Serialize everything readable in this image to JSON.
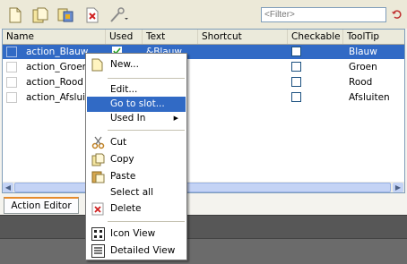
{
  "toolbar": {
    "icons": [
      "new-action-icon",
      "copy-action-icon",
      "configure-icon",
      "delete-icon",
      "tools-icon"
    ],
    "filter_placeholder": "<Filter>"
  },
  "table": {
    "columns": [
      "Name",
      "Used",
      "Text",
      "Shortcut",
      "Checkable",
      "ToolTip"
    ],
    "rows": [
      {
        "name": "action_Blauw",
        "used": true,
        "text": "&Blauw",
        "shortcut": "",
        "checkable": false,
        "tooltip": "Blauw",
        "selected": true
      },
      {
        "name": "action_Groen",
        "used": false,
        "text": "",
        "shortcut": "",
        "checkable": false,
        "tooltip": "Groen",
        "selected": false
      },
      {
        "name": "action_Rood",
        "used": false,
        "text": "",
        "shortcut": "",
        "checkable": false,
        "tooltip": "Rood",
        "selected": false
      },
      {
        "name": "action_Afsluiten",
        "used": false,
        "text": "",
        "shortcut": "",
        "checkable": false,
        "tooltip": "Afsluiten",
        "selected": false
      }
    ]
  },
  "tabs": {
    "action_editor": "Action Editor"
  },
  "context_menu": {
    "new": "New...",
    "edit": "Edit...",
    "go_to_slot": "Go to slot...",
    "used_in": "Used In",
    "cut": "Cut",
    "copy": "Copy",
    "paste": "Paste",
    "select_all": "Select all",
    "delete": "Delete",
    "icon_view": "Icon View",
    "detailed_view": "Detailed View"
  },
  "colors": {
    "selection": "#316ac5",
    "tab_accent": "#e68b2c"
  }
}
